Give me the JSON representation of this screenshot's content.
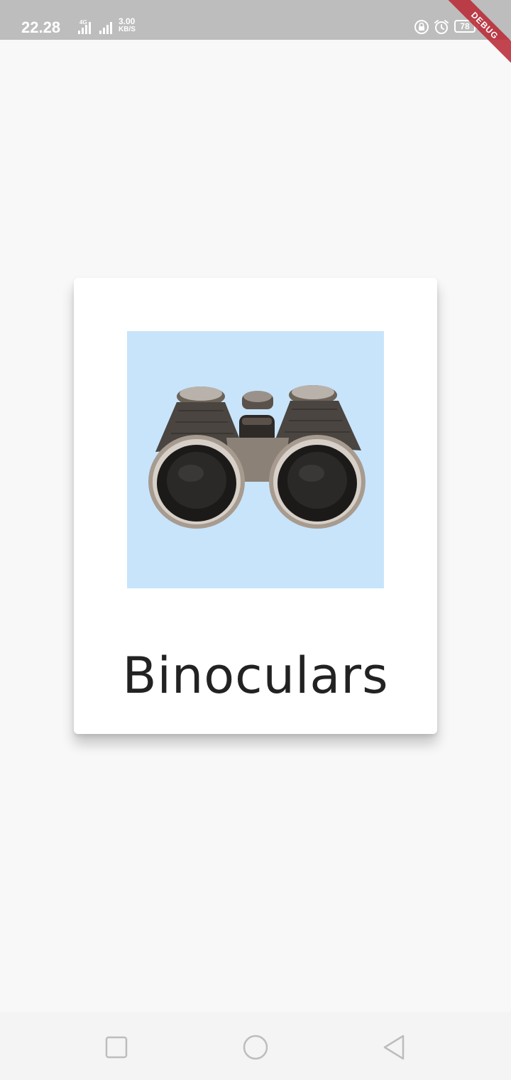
{
  "status_bar": {
    "time": "22.28",
    "network_type": "4G",
    "network_speed_value": "3.00",
    "network_speed_unit": "KB/S",
    "battery_level": "78",
    "icons": [
      "signal-icon",
      "signal-icon",
      "lock-rotation-icon",
      "alarm-icon",
      "battery-icon",
      "charging-icon"
    ]
  },
  "debug_banner": {
    "label": "DEBUG",
    "color": "#b82a37"
  },
  "card": {
    "image_description_icon": "binoculars-image",
    "image_background": "#c8e4fb",
    "title": "Binoculars"
  },
  "nav_bar": {
    "icons": [
      "recent-apps-icon",
      "home-icon",
      "back-icon"
    ]
  }
}
